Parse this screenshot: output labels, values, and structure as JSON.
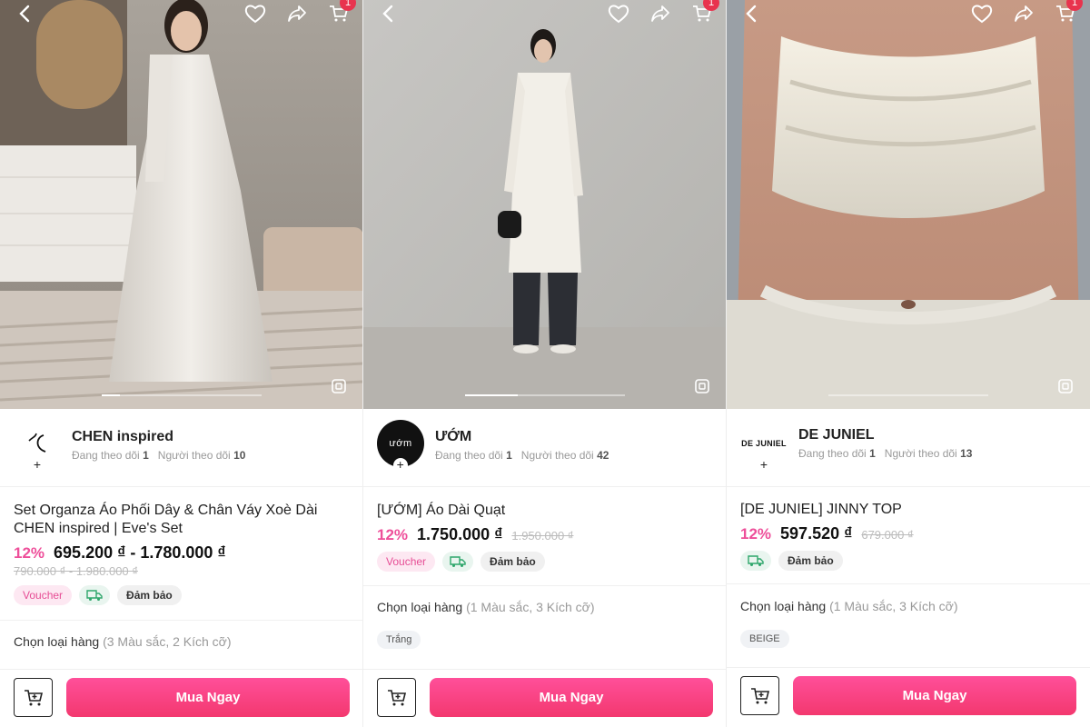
{
  "panels": [
    {
      "cart_count": "1",
      "shop": {
        "name": "CHEN inspired",
        "following_label": "Đang theo dõi",
        "following": "1",
        "followers_label": "Người theo dõi",
        "followers": "10",
        "logo_text": ""
      },
      "product": {
        "title": "Set Organza Áo Phối Dây & Chân Váy Xoè Dài CHEN inspired | Eve's Set",
        "discount": "12%",
        "price": "695.200 ₫ - 1.780.000 ₫",
        "old_price": "790.000 ₫ - 1.980.000 ₫"
      },
      "tags": {
        "voucher": "Voucher",
        "guarantee": "Đảm bảo"
      },
      "variants": {
        "label": "Chọn loại hàng",
        "detail": "(3 Màu sắc, 2 Kích cỡ)",
        "chip": ""
      },
      "buy_label": "Mua Ngay"
    },
    {
      "cart_count": "1",
      "shop": {
        "name": "ƯỚM",
        "following_label": "Đang theo dõi",
        "following": "1",
        "followers_label": "Người theo dõi",
        "followers": "42",
        "logo_text": "ướm"
      },
      "product": {
        "title": "[ƯỚM] Áo Dài Quạt",
        "discount": "12%",
        "price": "1.750.000 ₫",
        "old_price": "1.950.000 ₫"
      },
      "tags": {
        "voucher": "Voucher",
        "guarantee": "Đảm bảo"
      },
      "variants": {
        "label": "Chọn loại hàng",
        "detail": "(1 Màu sắc, 3 Kích cỡ)",
        "chip": "Trắng"
      },
      "buy_label": "Mua Ngay"
    },
    {
      "cart_count": "1",
      "shop": {
        "name": "DE JUNIEL",
        "following_label": "Đang theo dõi",
        "following": "1",
        "followers_label": "Người theo dõi",
        "followers": "13",
        "logo_text": "DE JUNIEL"
      },
      "product": {
        "title": "[DE JUNIEL] JINNY TOP",
        "discount": "12%",
        "price": "597.520 ₫",
        "old_price": "679.000 ₫"
      },
      "tags": {
        "voucher": "",
        "guarantee": "Đảm bảo"
      },
      "variants": {
        "label": "Chọn loại hàng",
        "detail": "(1 Màu sắc, 3 Kích cỡ)",
        "chip": "BEIGE"
      },
      "buy_label": "Mua Ngay"
    }
  ],
  "colors": {
    "accent": "#ee4f9a",
    "buy_button": "#f3386f",
    "badge": "#e8344e",
    "ship": "#2ea66b"
  },
  "icons": [
    "back-icon",
    "heart-icon",
    "share-icon",
    "cart-icon",
    "expand-icon",
    "truck-icon",
    "add-to-cart-icon"
  ]
}
